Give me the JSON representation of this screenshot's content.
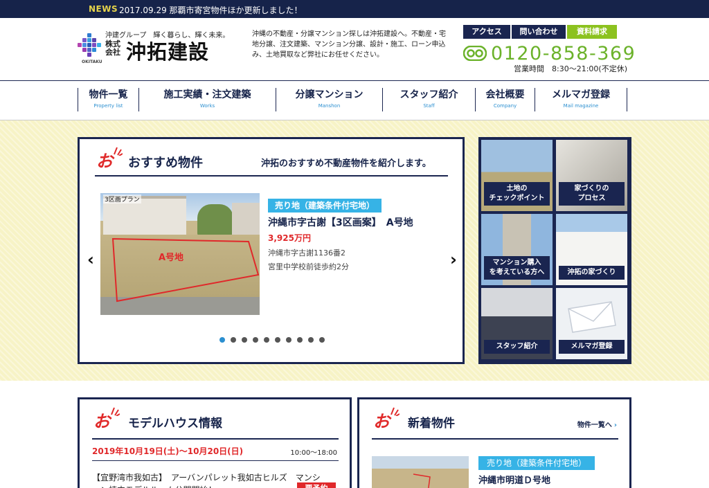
{
  "news": {
    "tag": "NEWS",
    "text": "2017.09.29 那覇市寄宮物件ほか更新しました！"
  },
  "header": {
    "logo": {
      "tagline": "沖建グループ　輝く暮らし、輝く未来。",
      "kaisha": "株式会社",
      "name": "沖拓建設",
      "sub": "OKITAKU"
    },
    "intro": "沖縄の不動産・分譲マンション探しは沖拓建設へ。不動産・宅地分譲、注文建築、マンション分譲、設計・施工、ローン申込み、土地買取など弊社にお任せください。",
    "buttons": {
      "access": "アクセス",
      "contact": "問い合わせ",
      "docs": "資料請求"
    },
    "phone": "0120-858-369",
    "hours": "営業時間　8:30～21:00(不定休)",
    "phone_icon": "freedial-icon"
  },
  "nav": [
    {
      "jp": "物件一覧",
      "en": "Property list"
    },
    {
      "jp": "施工実績・注文建築",
      "en": "Works"
    },
    {
      "jp": "分譲マンション",
      "en": "Manshon"
    },
    {
      "jp": "スタッフ紹介",
      "en": "Staff"
    },
    {
      "jp": "会社概要",
      "en": "Company"
    },
    {
      "jp": "メルマガ登録",
      "en": "Mail magazine"
    }
  ],
  "featured": {
    "title": "おすすめ物件",
    "lead": "沖拓のおすすめ不動産物件を紹介します。",
    "slide": {
      "photo_caption": "3区画プラン",
      "photo_label": "A号地",
      "badge": "売り地（建築条件付宅地）",
      "name": "沖縄市字古謝【3区画案】　A号地",
      "price": "3,925万円",
      "address": "沖縄市字古謝1136番2",
      "school": "宮里中学校前徒歩約2分"
    },
    "prev_label": "‹",
    "next_label": "›",
    "dot_count": 10,
    "active_dot": 0
  },
  "tiles": [
    {
      "label_line1": "土地の",
      "label_line2": "チェックポイント"
    },
    {
      "label_line1": "家づくりの",
      "label_line2": "プロセス"
    },
    {
      "label_line1": "マンション購入",
      "label_line2": "を考えている方へ"
    },
    {
      "label_line1": "沖拓の家づくり",
      "label_line2": ""
    },
    {
      "label_line1": "スタッフ紹介",
      "label_line2": ""
    },
    {
      "label_line1": "メルマガ登録",
      "label_line2": ""
    }
  ],
  "model_house": {
    "title": "モデルハウス情報",
    "date": "2019年10月19日(土)～10月20日(日)",
    "time": "10:00～18:00",
    "text": "【宜野湾市我如古】　アーバンパレット我如古ヒルズ　マンション棟内モデルルーム公開開始！",
    "tag": "要予約"
  },
  "new_listings": {
    "title": "新着物件",
    "more": "物件一覧へ",
    "badge": "売り地（建築条件付宅地）",
    "name": "沖縄市明道Ｄ号地"
  },
  "colors": {
    "navy": "#1a2550",
    "green": "#8cc21f",
    "red": "#e0282a",
    "sky": "#36b3e6"
  }
}
